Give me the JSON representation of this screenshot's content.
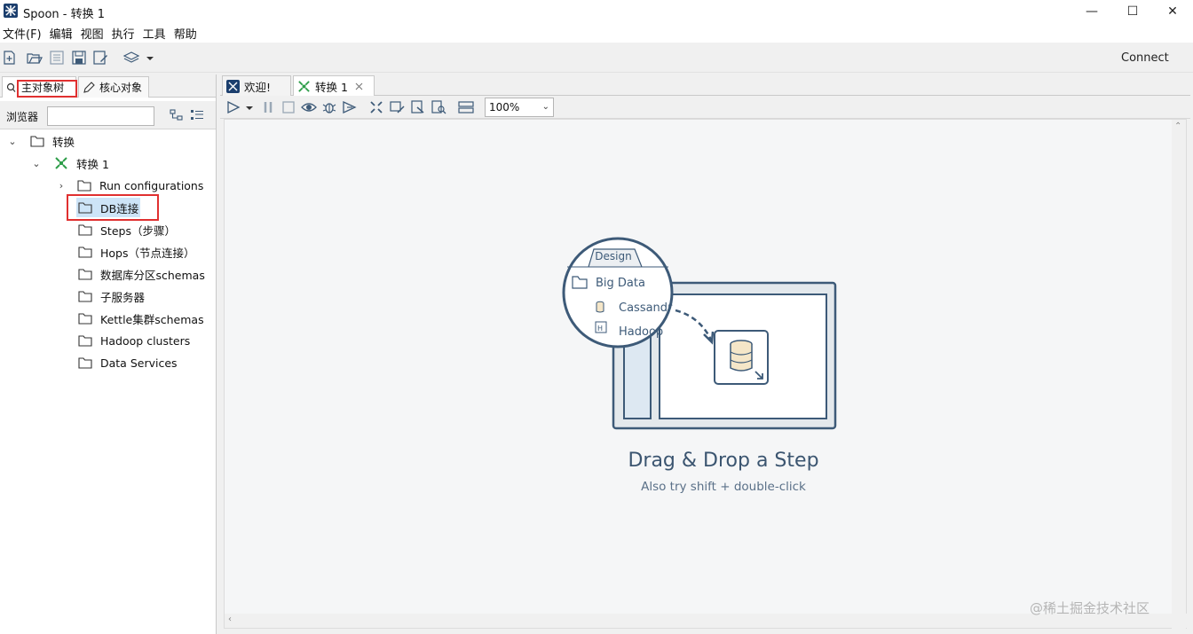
{
  "window": {
    "title": "Spoon - 转换 1",
    "min_glyph": "—",
    "max_glyph": "☐",
    "close_glyph": "✕"
  },
  "menu": [
    "文件(F)",
    "编辑",
    "视图",
    "执行",
    "工具",
    "帮助"
  ],
  "toolbar": {
    "connect_label": "Connect"
  },
  "left_panel": {
    "tabs": [
      "主对象树",
      "核心对象"
    ],
    "browser_label": "浏览器",
    "browser_input_value": "",
    "tree": [
      {
        "label": "转换"
      },
      {
        "label": "转换 1"
      },
      {
        "label": "Run configurations"
      },
      {
        "label": "DB连接"
      },
      {
        "label": "Steps（步骤）"
      },
      {
        "label": "Hops（节点连接）"
      },
      {
        "label": "数据库分区schemas"
      },
      {
        "label": "子服务器"
      },
      {
        "label": "Kettle集群schemas"
      },
      {
        "label": "Hadoop clusters"
      },
      {
        "label": "Data Services"
      }
    ]
  },
  "editor": {
    "tabs": [
      "欢迎!",
      "转换 1"
    ],
    "zoom": "100%"
  },
  "canvas": {
    "illustration": {
      "tab_label": "Design",
      "folder_label": "Big Data",
      "item_1": "Cassandr",
      "item_2": "Hadoop"
    },
    "title": "Drag & Drop a Step",
    "subtitle": "Also try shift + double-click"
  },
  "watermark": "@稀土掘金技术社区",
  "colors": {
    "highlight_red": "#e03030",
    "selection_blue": "#cde4f7",
    "illustration_stroke": "#3d5a78"
  }
}
